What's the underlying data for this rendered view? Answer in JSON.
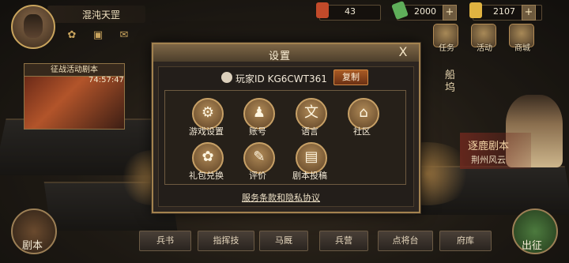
{
  "player": {
    "name": "混沌天罡"
  },
  "resources": [
    {
      "icon": "scroll-icon",
      "value": "43",
      "color": "#c24a2a"
    },
    {
      "icon": "jade-icon",
      "value": "2000",
      "color": "#5fae5a"
    },
    {
      "icon": "gold-ingot-icon",
      "value": "2107",
      "color": "#e0b341"
    }
  ],
  "campaign": {
    "title": "征战活动剧本",
    "timer": "74:57:47"
  },
  "nav": [
    {
      "label": "任务",
      "icon": "task-icon"
    },
    {
      "label": "活动",
      "icon": "event-icon"
    },
    {
      "label": "商城",
      "icon": "shop-icon"
    }
  ],
  "side": {
    "vertical": "船坞",
    "zhulu_title": "逐鹿剧本",
    "zhulu_sub": "荆州风云"
  },
  "bottom": {
    "left_round": "剧本",
    "right_round": "出征",
    "buttons": [
      "兵书",
      "指挥技",
      "马厩",
      "兵营",
      "点将台",
      "府库"
    ]
  },
  "settings": {
    "title": "设置",
    "close": "X",
    "player_id": "玩家ID KG6CWT361",
    "copy": "复制",
    "options": [
      {
        "label": "游戏设置",
        "icon": "gear-icon",
        "glyph": "⚙"
      },
      {
        "label": "账号",
        "icon": "account-icon",
        "glyph": "♟"
      },
      {
        "label": "语言",
        "icon": "language-icon",
        "glyph": "文"
      },
      {
        "label": "社区",
        "icon": "community-icon",
        "glyph": "⌂"
      },
      {
        "label": "礼包兑换",
        "icon": "gift-bag-icon",
        "glyph": "✿"
      },
      {
        "label": "评价",
        "icon": "review-icon",
        "glyph": "✎"
      },
      {
        "label": "剧本投稿",
        "icon": "script-submit-icon",
        "glyph": "▤"
      }
    ],
    "terms_link": "服务条款和隐私协议"
  }
}
